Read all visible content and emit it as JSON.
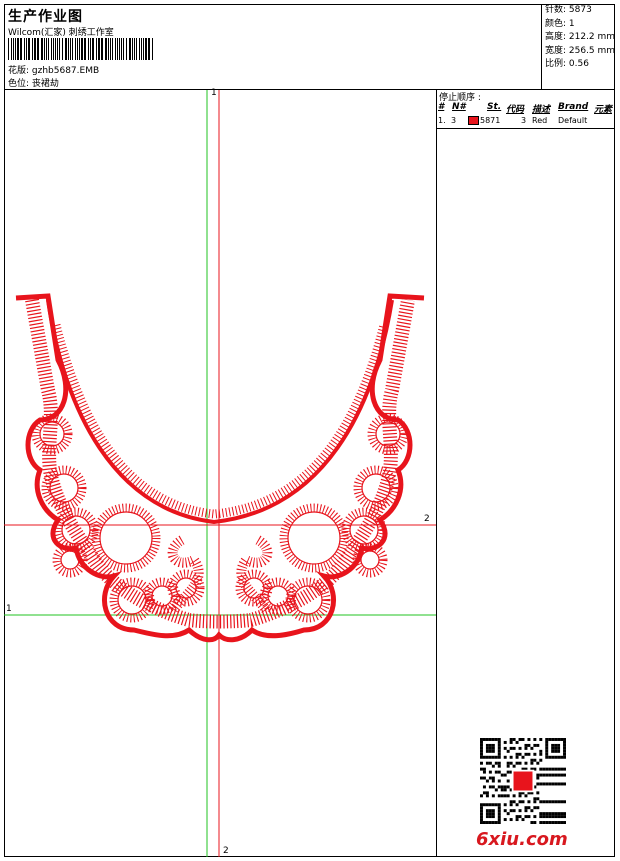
{
  "header": {
    "title": "生产作业图",
    "company": "Wilcom(汇家) 刺绣工作室",
    "design_label": "花版: gzhb5687.EMB",
    "color_label": "色位: 丧裙劫"
  },
  "stats": [
    "针数: 5873",
    "颜色: 1",
    "高度: 212.2 mm",
    "宽度: 256.5 mm",
    "比例: 0.56"
  ],
  "stop_panel": {
    "title": "停止顺序 :",
    "columns": [
      "#",
      "N#",
      "St.",
      "代码",
      "描述",
      "Brand",
      "元素"
    ],
    "rows": [
      {
        "num": "1.",
        "n": "3",
        "stitches": "5871",
        "code": "3",
        "desc": "Red",
        "brand": "Default",
        "color": "#e8141c"
      }
    ]
  },
  "guides": {
    "top_label": "1",
    "bottom_label": "2",
    "left_label": "1",
    "right_label": "2"
  },
  "embroidery_color": "#e8141c",
  "guide_colors": {
    "green": "#22c322",
    "red": "#e8141c"
  },
  "watermark": "6xiu.com"
}
